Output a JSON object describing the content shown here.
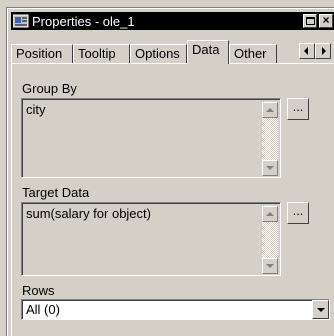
{
  "window": {
    "title": "Properties - ole_1"
  },
  "tabs": [
    {
      "label": "Position"
    },
    {
      "label": "Tooltip"
    },
    {
      "label": "Options"
    },
    {
      "label": "Data"
    },
    {
      "label": "Other"
    }
  ],
  "group_by": {
    "label": "Group By",
    "value": "city",
    "button_label": "..."
  },
  "target_data": {
    "label": "Target Data",
    "value": "sum(salary for object)",
    "button_label": "..."
  },
  "rows": {
    "label": "Rows",
    "selected": "All (0)"
  }
}
